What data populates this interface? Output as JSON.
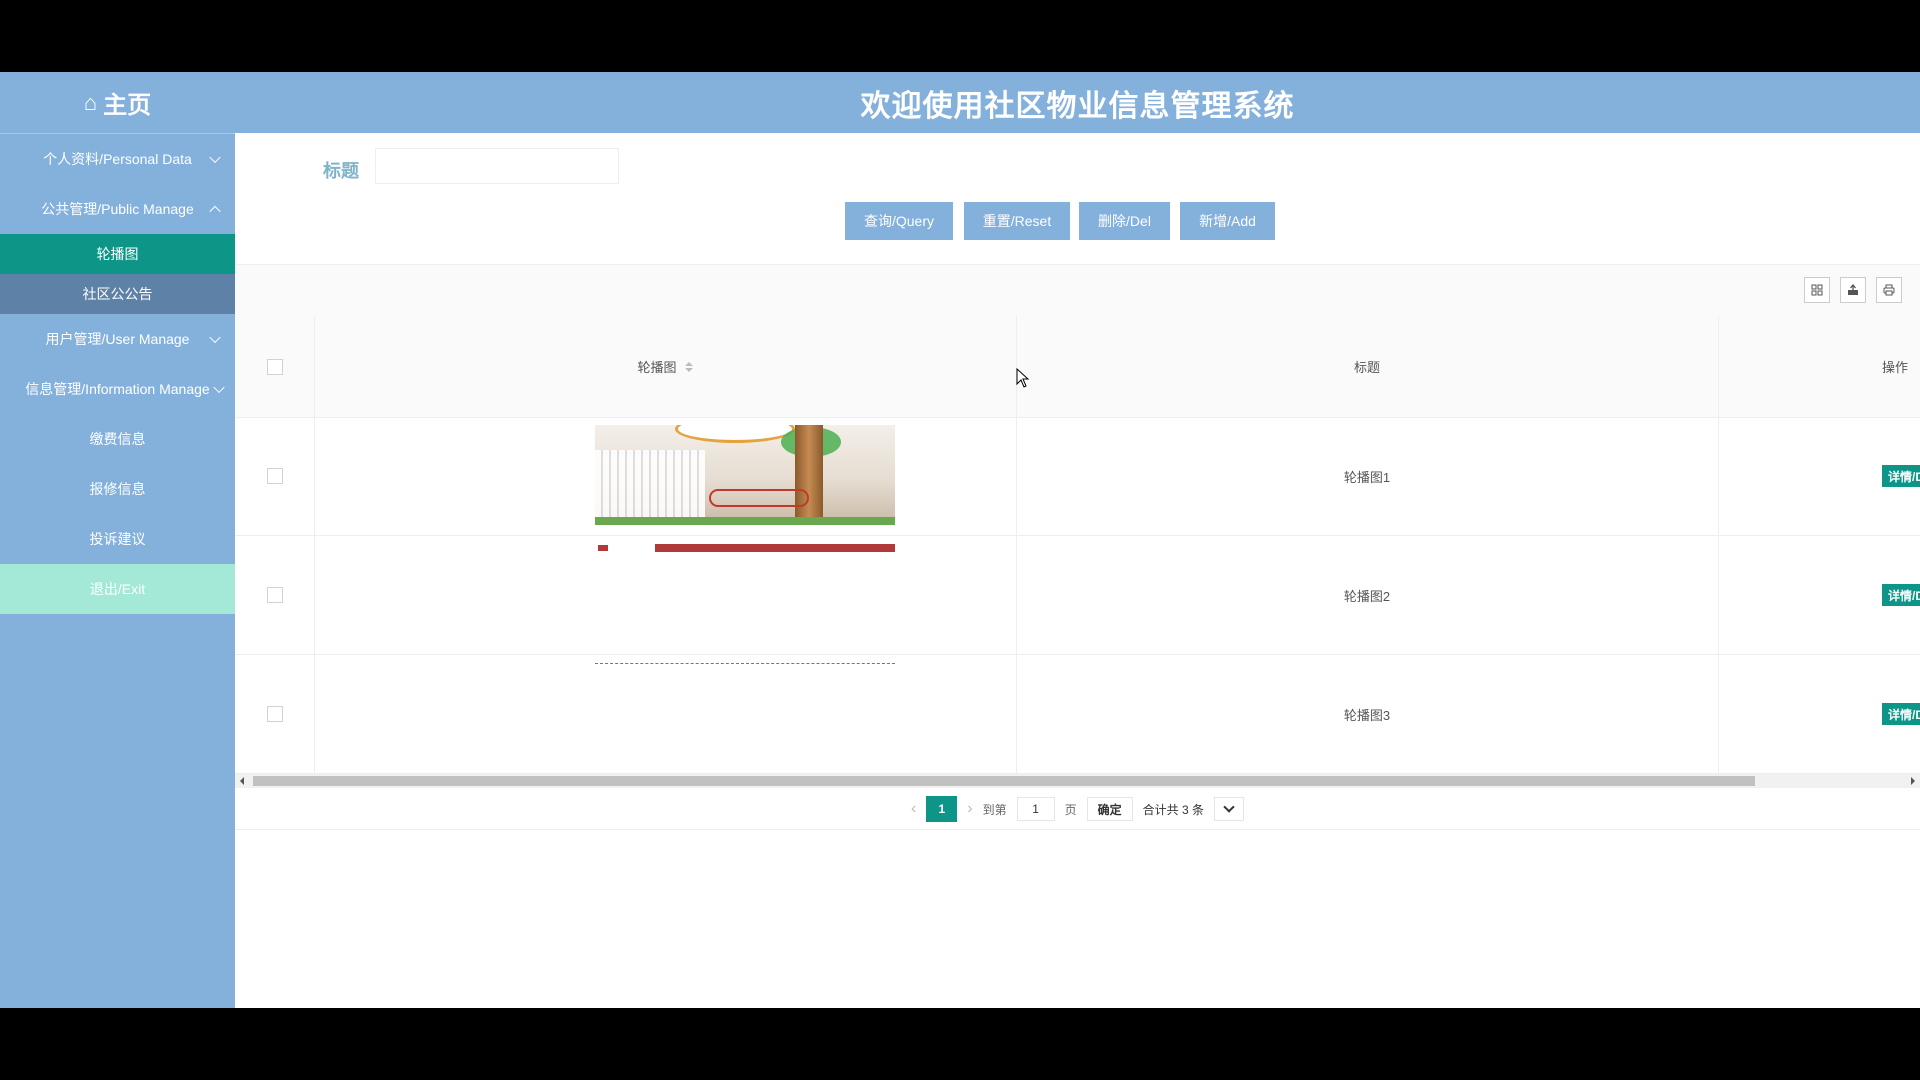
{
  "header": {
    "home_label": "主页",
    "home_icon": "home-icon",
    "system_title": "欢迎使用社区物业信息管理系统"
  },
  "sidebar": {
    "items": [
      {
        "label": "个人资料/Personal Data",
        "expanded": false
      },
      {
        "label": "公共管理/Public Manage",
        "expanded": true,
        "children": [
          {
            "label": "轮播图",
            "active": true
          },
          {
            "label": "社区公公告",
            "active": false
          }
        ]
      },
      {
        "label": "用户管理/User Manage",
        "expanded": false
      },
      {
        "label": "信息管理/Information Manage",
        "expanded": false
      },
      {
        "label": "缴费信息"
      },
      {
        "label": "报修信息"
      },
      {
        "label": "投诉建议"
      },
      {
        "label": "退出/Exit"
      }
    ]
  },
  "search": {
    "label": "标题",
    "value": ""
  },
  "buttons": {
    "query": "查询/Query",
    "reset": "重置/Reset",
    "delete": "删除/Del",
    "add": "新增/Add"
  },
  "toolbar": {
    "icons": [
      "columns-icon",
      "export-icon",
      "print-icon"
    ]
  },
  "table": {
    "columns": [
      "轮播图",
      "标题",
      "操作"
    ],
    "rows": [
      {
        "title": "轮播图1",
        "action": "详情/Detail"
      },
      {
        "title": "轮播图2",
        "action": "详情/Detail"
      },
      {
        "title": "轮播图3",
        "action": "详情/Detail"
      }
    ]
  },
  "pagination": {
    "current_page": "1",
    "goto_label": "到第",
    "goto_value": "1",
    "page_unit": "页",
    "confirm": "确定",
    "total": "合计共 3 条"
  },
  "colors": {
    "header_bg": "#84b0dc",
    "active_teal": "#0d9688",
    "submenu_bg": "#5e81a8",
    "exit_bg": "#a4e8d8"
  }
}
